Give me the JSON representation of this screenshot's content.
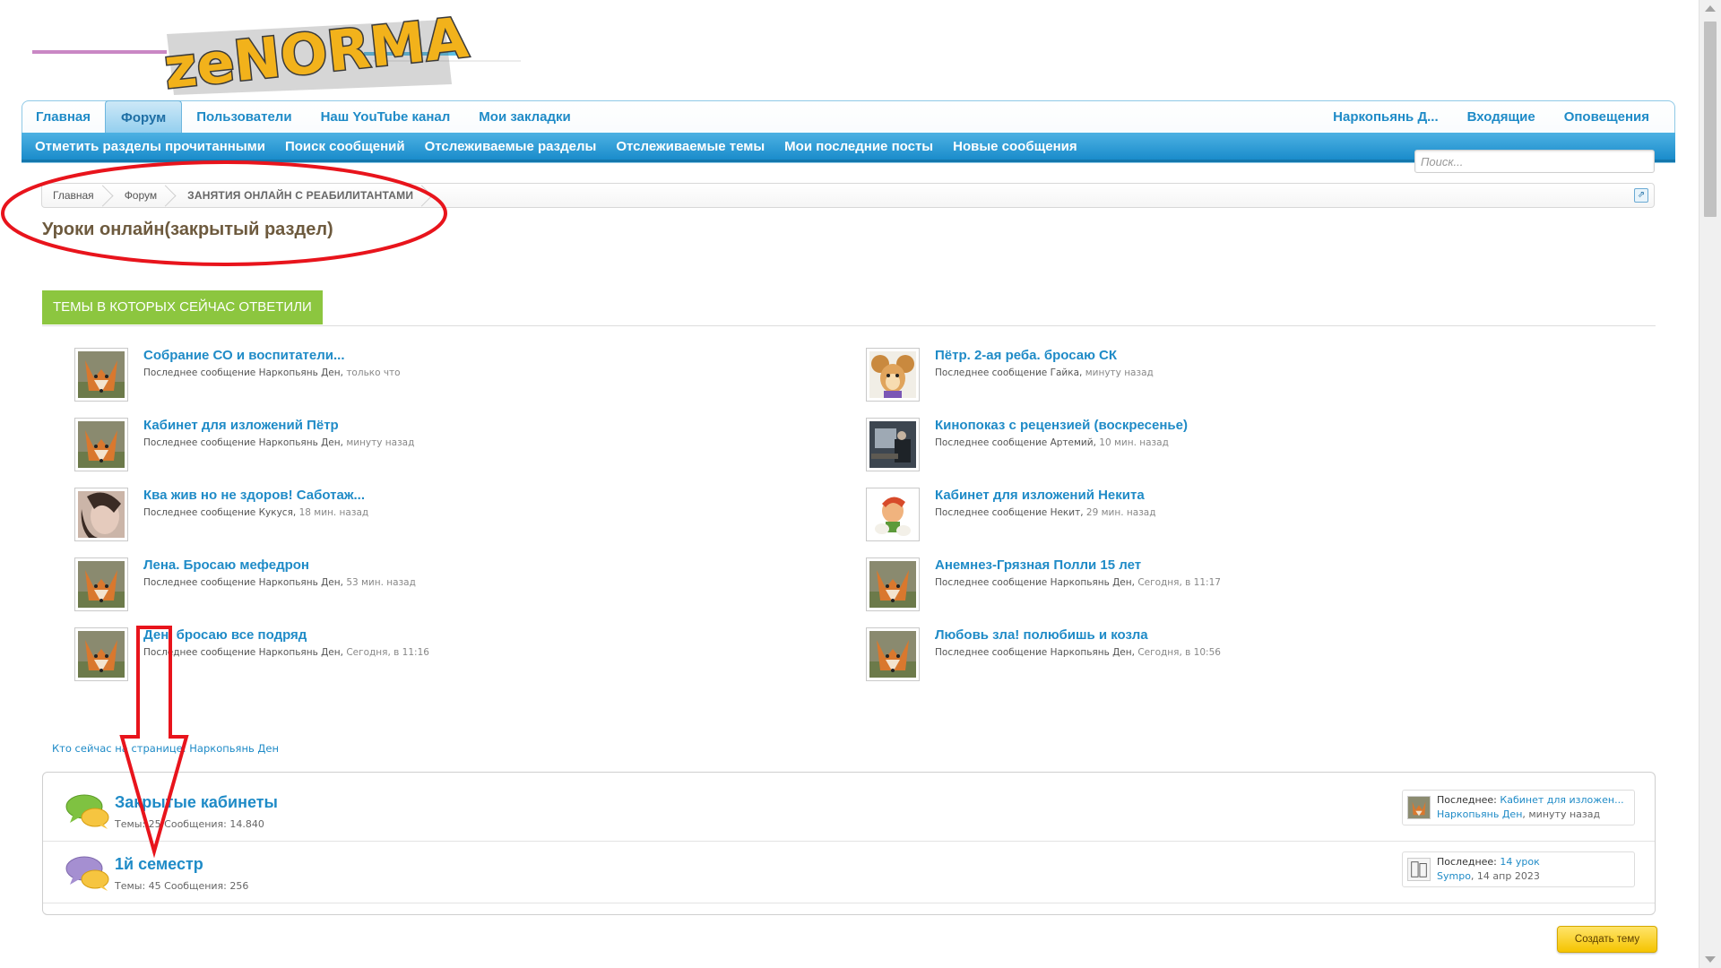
{
  "logo_text": "zeNORMA",
  "nav": {
    "tabs": [
      "Главная",
      "Форум",
      "Пользователи",
      "Наш YouTube канал",
      "Мои закладки"
    ],
    "active_tab": "Форум",
    "right": [
      "Наркопьянь Д...",
      "Входящие",
      "Оповещения"
    ]
  },
  "subnav": [
    "Отметить разделы прочитанными",
    "Поиск сообщений",
    "Отслеживаемые разделы",
    "Отслеживаемые темы",
    "Мои последние посты",
    "Новые сообщения"
  ],
  "search": {
    "placeholder": "Поиск..."
  },
  "breadcrumb": [
    "Главная",
    "Форум",
    "Занятия онлайн с реабилитантами"
  ],
  "page_title": "Уроки онлайн(закрытый раздел)",
  "recent": {
    "heading": "Темы в которых сейчас ответили",
    "threads": [
      {
        "title": "Собрание СО и воспитатели...",
        "meta": "Последнее сообщение Наркопьянь Ден,",
        "time": "только что",
        "avatar": "fox-avatar"
      },
      {
        "title": "Пётр. 2-ая реба. бросаю СК",
        "meta": "Последнее сообщение Гайка,",
        "time": "минуту назад",
        "avatar": "mouse-avatar"
      },
      {
        "title": "Кабинет для изложений Пётр",
        "meta": "Последнее сообщение Наркопьянь Ден,",
        "time": "минуту назад",
        "avatar": "fox-avatar"
      },
      {
        "title": "Кинопоказ с рецензией (воскресенье)",
        "meta": "Последнее сообщение Артемий,",
        "time": "10 мин. назад",
        "avatar": "photo-avatar"
      },
      {
        "title": "Ква жив но не здоров! Саботаж...",
        "meta": "Последнее сообщение Кукуся,",
        "time": "18 мин. назад",
        "avatar": "girl-avatar"
      },
      {
        "title": "Кабинет для изложений Некита",
        "meta": "Последнее сообщение Некит,",
        "time": "29 мин. назад",
        "avatar": "cartoon-avatar"
      },
      {
        "title": "Лена. Бросаю мефедрон",
        "meta": "Последнее сообщение Наркопьянь Ден,",
        "time": "53 мин. назад",
        "avatar": "fox-avatar"
      },
      {
        "title": "Анемнез-Грязная Полли 15 лет",
        "meta": "Последнее сообщение Наркопьянь Ден,",
        "time": "Сегодня, в 11:17",
        "avatar": "fox-avatar"
      },
      {
        "title": "Ден, бросаю все подряд",
        "meta": "Последнее сообщение Наркопьянь Ден,",
        "time": "Сегодня, в 11:16",
        "avatar": "fox-avatar"
      },
      {
        "title": "Любовь зла! полюбишь и козла",
        "meta": "Последнее сообщение Наркопьянь Ден,",
        "time": "Сегодня, в 10:56",
        "avatar": "fox-avatar"
      }
    ]
  },
  "who_online": "Кто сейчас на странице: Наркопьянь Ден",
  "forums": [
    {
      "title": "Закрытые кабинеты",
      "stats": "Темы: 25 Сообщения: 14.840",
      "last_label": "Последнее:",
      "last_thread": "Кабинет для изложен...",
      "last_user": "Наркопьянь Ден",
      "last_time": ", минуту назад",
      "icon_color": "#7fc241"
    },
    {
      "title": "1й семестр",
      "stats": "Темы: 45 Сообщения: 256",
      "last_label": "Последнее:",
      "last_thread": "14 урок",
      "last_user": "Sympo",
      "last_time": ", 14 апр 2023",
      "icon_color": "#a58fd1"
    }
  ],
  "create_button": "Создать тему",
  "colors": {
    "link": "#1f8bc7",
    "green_tab": "#8cc63f",
    "annotation": "#e8141c"
  }
}
